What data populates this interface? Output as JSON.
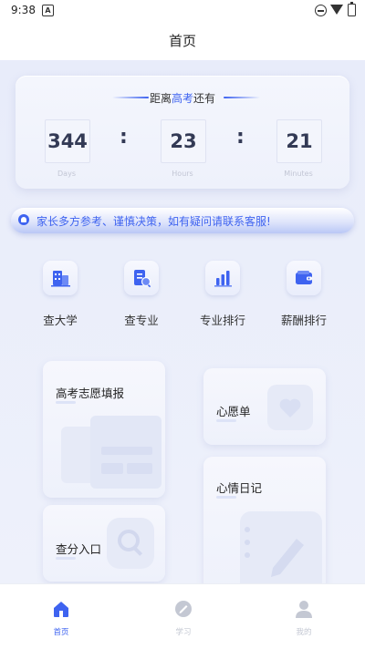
{
  "status_bar": {
    "time": "9:38",
    "a_badge": "A"
  },
  "header": {
    "title": "首页"
  },
  "countdown": {
    "heading_prefix": "距离",
    "heading_highlight": "高考",
    "heading_suffix": "还有",
    "days": "344",
    "hours": "23",
    "minutes": "21",
    "days_label": "Days",
    "hours_label": "Hours",
    "minutes_label": "Minutes",
    "separator": ":"
  },
  "notice": {
    "text": "家长多方参考、谨慎决策，如有疑问请联系客服!"
  },
  "categories": [
    {
      "label": "查大学",
      "icon": "university-icon"
    },
    {
      "label": "查专业",
      "icon": "major-icon"
    },
    {
      "label": "专业排行",
      "icon": "ranking-chart-icon"
    },
    {
      "label": "薪酬排行",
      "icon": "wallet-icon"
    }
  ],
  "cards": {
    "application": "高考志愿填报",
    "wishlist": "心愿单",
    "mood_diary": "心情日记",
    "score_query": "查分入口"
  },
  "tabs": [
    {
      "label": "首页",
      "active": true
    },
    {
      "label": "学习",
      "active": false
    },
    {
      "label": "我的",
      "active": false
    }
  ],
  "colors": {
    "accent": "#3e63f0",
    "background": "#e8ecfa",
    "inactive_tab": "#c4c8d3"
  }
}
